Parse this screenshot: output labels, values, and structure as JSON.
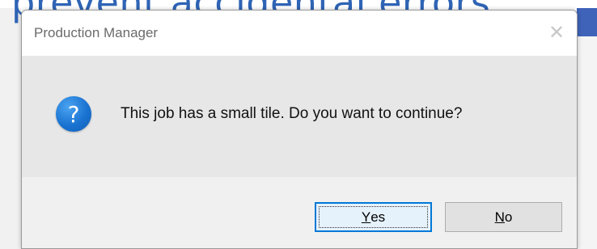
{
  "background": {
    "heading_text": "prevent accidental errors",
    "heading_color": "#2f64b5"
  },
  "dialog": {
    "title": "Production Manager",
    "close_glyph": "✕",
    "icon": "question-icon",
    "icon_glyph": "?",
    "icon_color": "#1a73d1",
    "message": "This job has a small tile. Do you want to continue?",
    "buttons": {
      "yes": {
        "accel": "Y",
        "rest": "es"
      },
      "no": {
        "accel": "N",
        "rest": "o"
      }
    }
  }
}
